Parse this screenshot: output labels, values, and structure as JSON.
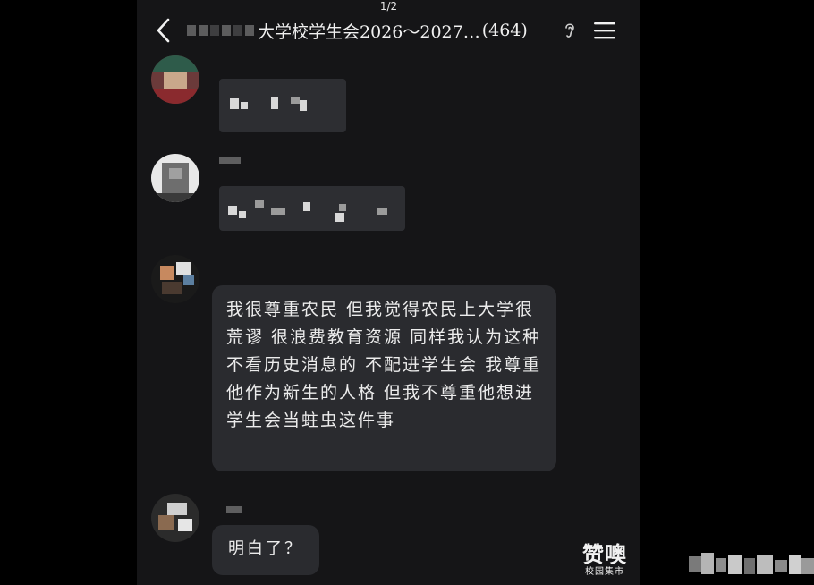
{
  "pager": "1/2",
  "header": {
    "title": "大学校学生会2026～2027…",
    "member_count": "(464)"
  },
  "icons": {
    "back": "chevron-left-icon",
    "ear": "ear-icon",
    "menu": "hamburger-menu-icon"
  },
  "messages": [
    {
      "sender": "blurred",
      "content": "blurred"
    },
    {
      "sender": "blurred",
      "content": "blurred"
    },
    {
      "sender": "blurred",
      "text": "我很尊重农民 但我觉得农民上大学很荒谬 很浪费教育资源 同样我认为这种不看历史消息的 不配进学生会 我尊重他作为新生的人格 但我不尊重他想进学生会当蛀虫这件事"
    },
    {
      "sender": "blurred",
      "text": "明白了？"
    }
  ],
  "watermark": {
    "main": "赞噢",
    "sub": "校园集市"
  },
  "colors": {
    "background": "#000000",
    "chat_bg": "#151517",
    "bubble": "#2a2b2f",
    "text": "#ececec"
  }
}
